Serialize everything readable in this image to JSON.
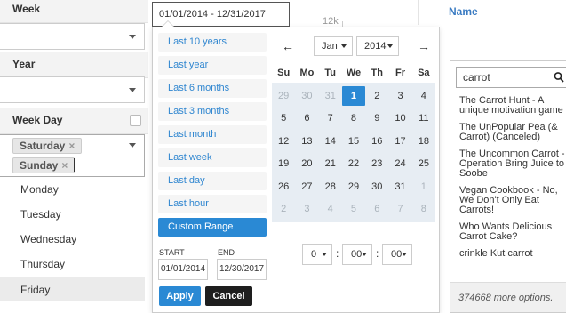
{
  "filters": {
    "week_label": "Week",
    "year_label": "Year",
    "weekday_label": "Week Day",
    "tags": [
      {
        "label": "Saturday",
        "remove": "×"
      },
      {
        "label": "Sunday",
        "remove": "×"
      }
    ],
    "day_options": [
      "Monday",
      "Tuesday",
      "Wednesday",
      "Thursday",
      "Friday"
    ]
  },
  "chart": {
    "tick": "12k"
  },
  "search_column": {
    "header": "Name",
    "query": "carrot",
    "options": [
      "The Carrot Hunt - A unique motivation game",
      "The UnPopular Pea (& Carrot) (Canceled)",
      "The Uncommon Carrot - Operation Bring Juice to Soobe",
      "Vegan Cookbook - No, We Don't Only Eat Carrots!",
      "Who Wants Delicious Carrot Cake?",
      "crinkle Kut carrot"
    ],
    "more": "374668 more options."
  },
  "datepicker": {
    "range_value": "01/01/2014 - 12/31/2017",
    "ranges": [
      "Last 10 years",
      "Last year",
      "Last 6 months",
      "Last 3 months",
      "Last month",
      "Last week",
      "Last day",
      "Last hour",
      "Custom Range"
    ],
    "active_range": "Custom Range",
    "start_label": "START",
    "end_label": "END",
    "start_value": "01/01/2014",
    "end_value": "12/30/2017",
    "apply": "Apply",
    "cancel": "Cancel",
    "prev": "←",
    "next": "→",
    "month": "Jan",
    "year": "2014",
    "weekdays": [
      "Su",
      "Mo",
      "Tu",
      "We",
      "Th",
      "Fr",
      "Sa"
    ],
    "weeks": [
      [
        "29",
        "30",
        "31",
        "1",
        "2",
        "3",
        "4"
      ],
      [
        "5",
        "6",
        "7",
        "8",
        "9",
        "10",
        "11"
      ],
      [
        "12",
        "13",
        "14",
        "15",
        "16",
        "17",
        "18"
      ],
      [
        "19",
        "20",
        "21",
        "22",
        "23",
        "24",
        "25"
      ],
      [
        "26",
        "27",
        "28",
        "29",
        "30",
        "31",
        "1"
      ],
      [
        "2",
        "3",
        "4",
        "5",
        "6",
        "7",
        "8"
      ]
    ],
    "time": {
      "hour": "0",
      "minute": "00",
      "second": "00"
    }
  },
  "colors": {
    "accent": "#2a89d4",
    "link": "#2f86d0",
    "header_link": "#3a7bc2",
    "cancel": "#1e1e1e"
  }
}
